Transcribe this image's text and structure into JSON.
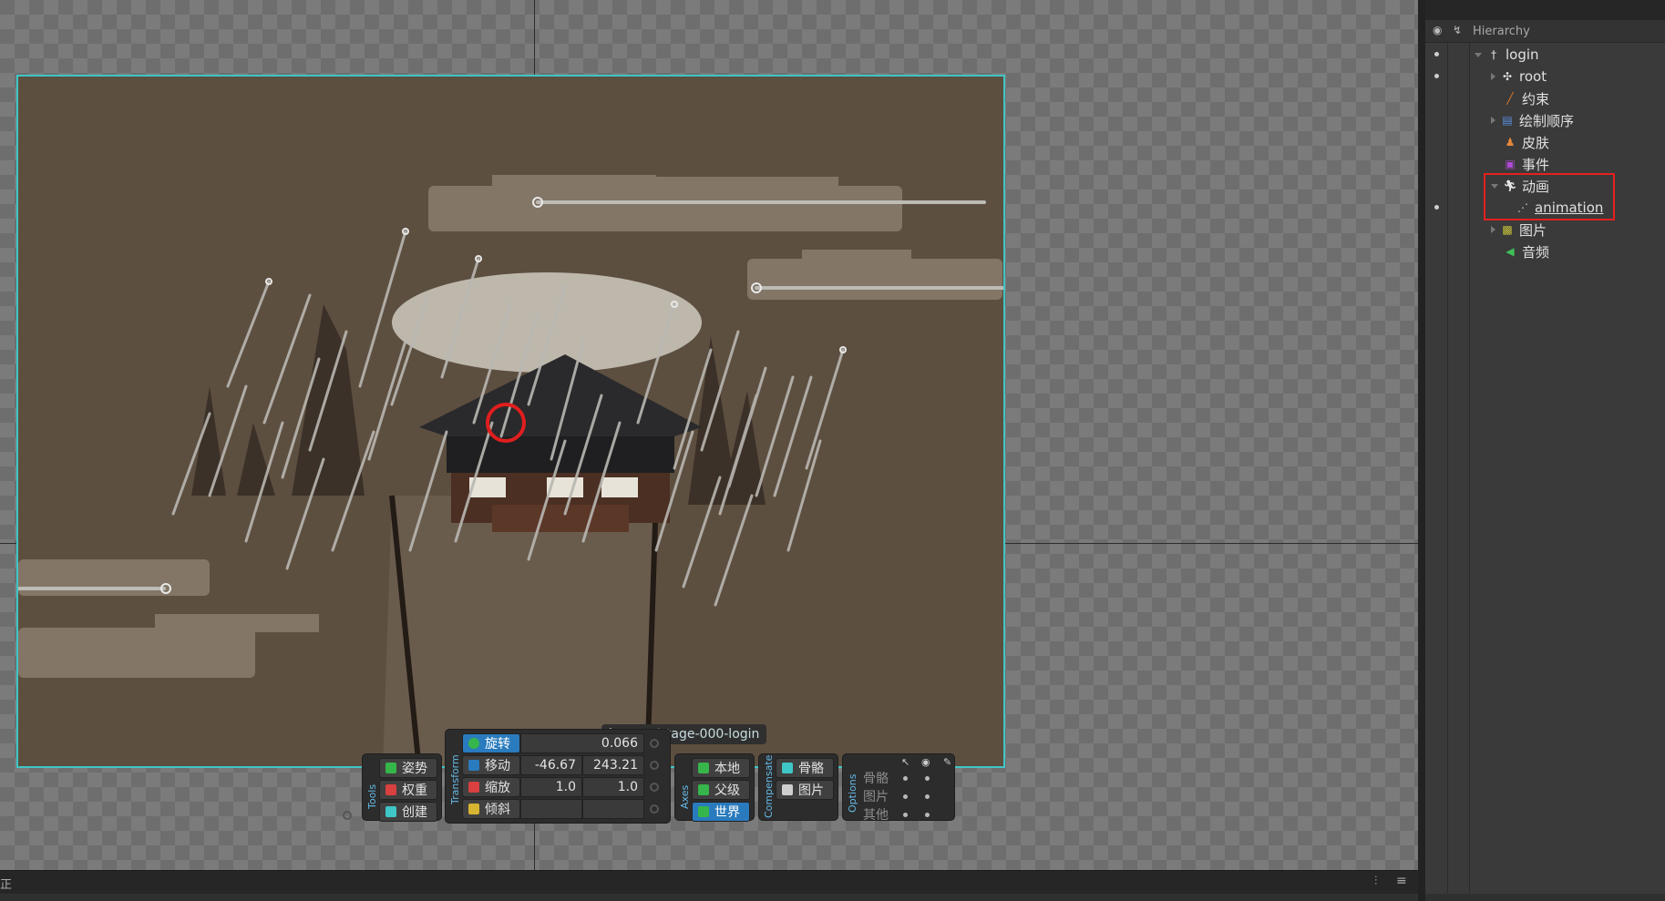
{
  "stage": {
    "image_path": "images/stage-000-login"
  },
  "toolbar": {
    "tools": {
      "section_label": "Tools",
      "pose": "姿势",
      "weights": "权重",
      "create": "创建"
    },
    "transform": {
      "section_label": "Transform",
      "rotate": {
        "label": "旋转",
        "value": "0.066"
      },
      "translate": {
        "label": "移动",
        "x": "-46.67",
        "y": "243.21"
      },
      "scale": {
        "label": "缩放",
        "x": "1.0",
        "y": "1.0"
      },
      "shear": {
        "label": "倾斜",
        "x": "",
        "y": ""
      }
    },
    "axes": {
      "section_label": "Axes",
      "local": "本地",
      "parent": "父级",
      "world": "世界"
    },
    "compensate": {
      "section_label": "Compensate",
      "bones": "骨骼",
      "images": "图片"
    },
    "options": {
      "section_label": "Options",
      "rows": [
        "骨骼",
        "图片",
        "其他"
      ]
    }
  },
  "status": {
    "left_text": "正"
  },
  "hierarchy": {
    "title": "Hierarchy",
    "items": [
      {
        "label": "login",
        "icon": "skeleton-icon"
      },
      {
        "label": "root",
        "icon": "bone-icon"
      },
      {
        "label": "约束",
        "icon": "constraint-icon"
      },
      {
        "label": "绘制顺序",
        "icon": "draw-order-icon"
      },
      {
        "label": "皮肤",
        "icon": "skin-icon"
      },
      {
        "label": "事件",
        "icon": "event-icon"
      },
      {
        "label": "动画",
        "icon": "animation-icon"
      },
      {
        "label": "animation",
        "icon": "animation-clip-icon"
      },
      {
        "label": "图片",
        "icon": "images-folder-icon"
      },
      {
        "label": "音频",
        "icon": "audio-icon"
      }
    ]
  },
  "colors": {
    "stage_border": "#3fc6c6",
    "selection_box": "#e52020",
    "active_button": "#2a7bbd"
  }
}
